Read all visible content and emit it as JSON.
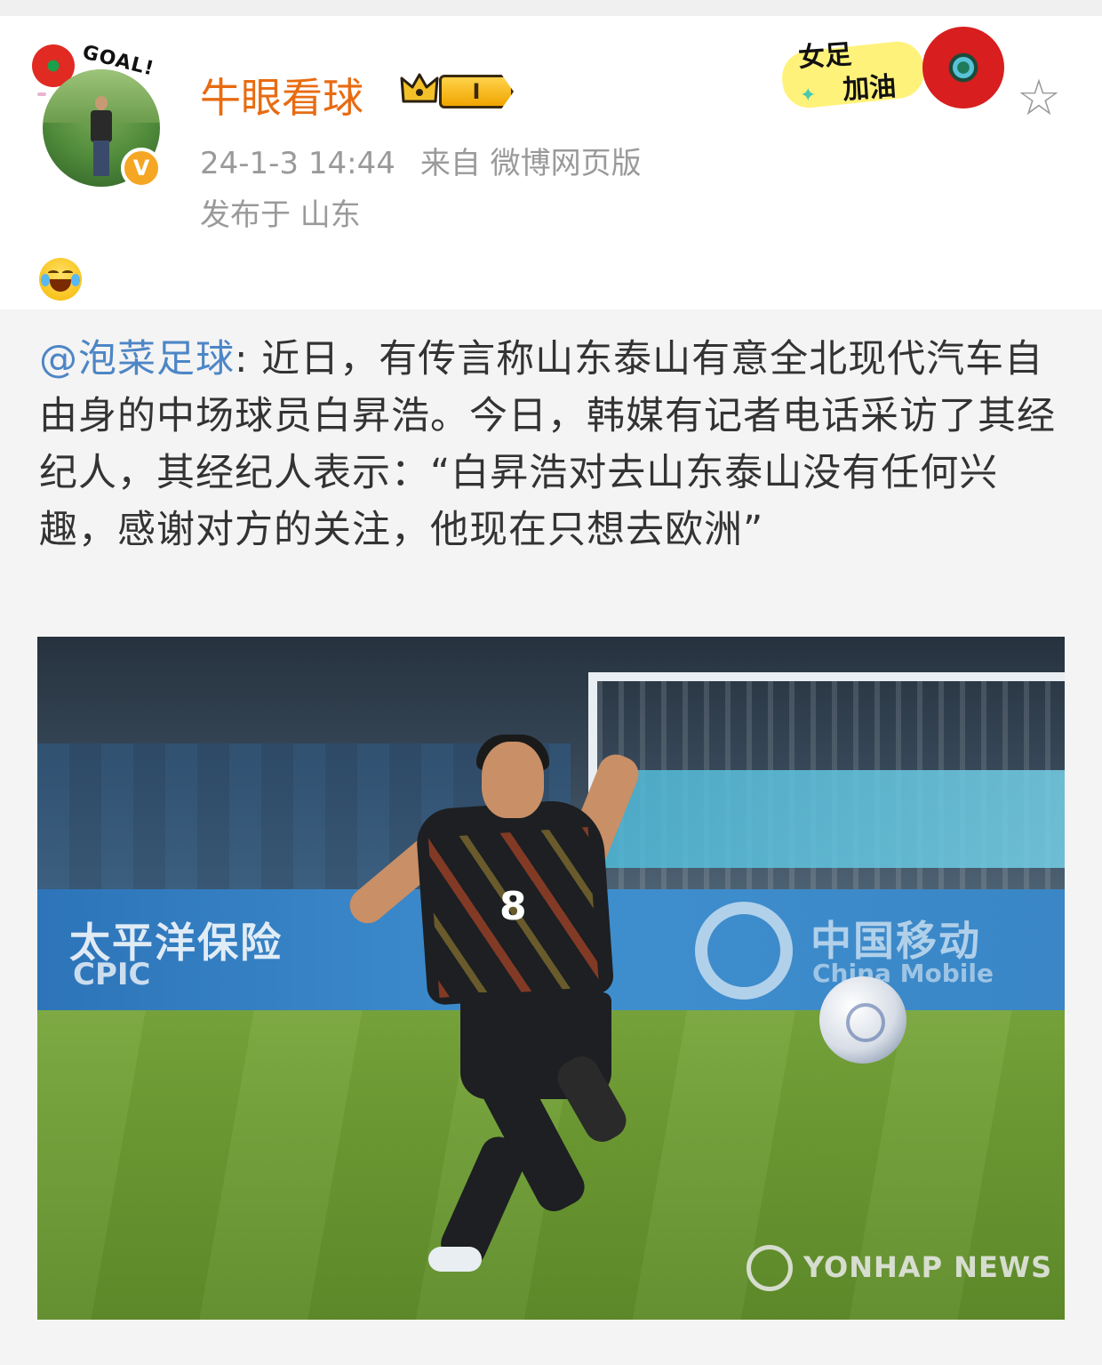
{
  "post": {
    "author": {
      "name": "牛眼看球",
      "level_badge": "I",
      "avatar_badge_text": "GOAL!",
      "verified_mark": "V"
    },
    "timestamp": "24-1-3 14:44",
    "source": "来自 微博网页版",
    "location": "发布于 山东",
    "sticker": {
      "line1": "女足",
      "line2": "加油"
    },
    "favorite_icon": "star-outline-icon",
    "emoji": "laughing-crying-emoji"
  },
  "repost": {
    "mention": "@泡菜足球",
    "text": ": 近日，有传言称山东泰山有意全北现代汽车自由身的中场球员白昇浩。今日，韩媒有记者电话采访了其经纪人，其经纪人表示：“白昇浩对去山东泰山没有任何兴趣，感谢对方的关注，他现在只想去欧洲”"
  },
  "photo": {
    "jersey_number": "8",
    "watermark": "YONHAP NEWS"
  },
  "colors": {
    "username": "#e86b12",
    "mention": "#4d86c6",
    "meta": "#9a9a9a",
    "verified": "#f5a623"
  }
}
